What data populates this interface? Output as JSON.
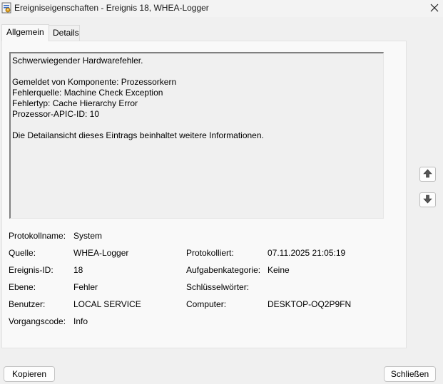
{
  "window": {
    "title": "Ereigniseigenschaften - Ereignis 18, WHEA-Logger",
    "icon": "event-viewer-icon",
    "close_icon": "close-icon"
  },
  "tabs": [
    {
      "label": "Allgemein",
      "active": true
    },
    {
      "label": "Details",
      "active": false
    }
  ],
  "description": {
    "lines": [
      "Schwerwiegender Hardwarefehler.",
      "",
      "Gemeldet von Komponente: Prozessorkern",
      "Fehlerquelle: Machine Check Exception",
      "Fehlertyp: Cache Hierarchy Error",
      "Prozessor-APIC-ID: 10",
      "",
      "Die Detailansicht dieses Eintrags beinhaltet weitere Informationen."
    ]
  },
  "navigation": {
    "up_icon": "arrow-up-icon",
    "down_icon": "arrow-down-icon"
  },
  "properties": {
    "log_name_label": "Protokollname:",
    "log_name_value": "System",
    "source_label": "Quelle:",
    "source_value": "WHEA-Logger",
    "logged_label": "Protokolliert:",
    "logged_value": "07.11.2025 21:05:19",
    "event_id_label": "Ereignis-ID:",
    "event_id_value": "18",
    "task_category_label": "Aufgabenkategorie:",
    "task_category_value": "Keine",
    "level_label": "Ebene:",
    "level_value": "Fehler",
    "keywords_label": "Schlüsselwörter:",
    "keywords_value": "",
    "user_label": "Benutzer:",
    "user_value": "LOCAL SERVICE",
    "computer_label": "Computer:",
    "computer_value": "DESKTOP-OQ2P9FN",
    "opcode_label": "Vorgangscode:",
    "opcode_value": "Info"
  },
  "buttons": {
    "copy": "Kopieren",
    "close": "Schließen"
  }
}
